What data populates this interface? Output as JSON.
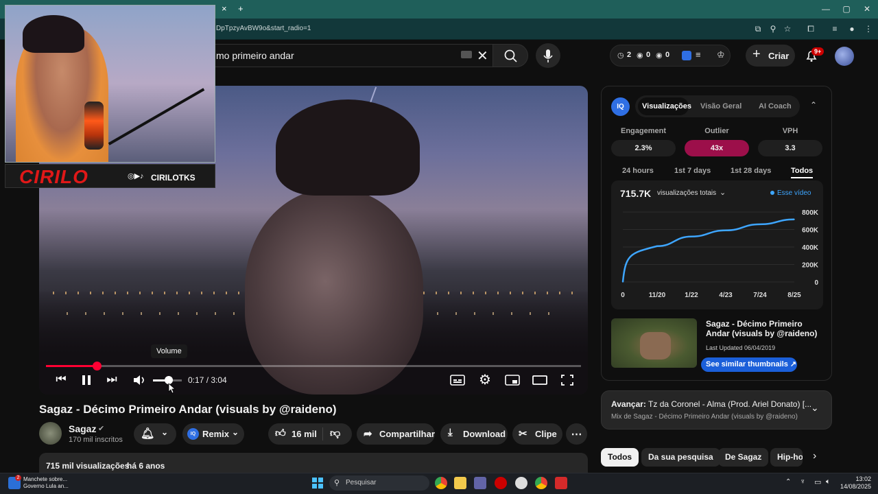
{
  "browser": {
    "url_text": "DpTpzyAvBW9o&start_radio=1",
    "tab_close": "×",
    "tab_new": "+",
    "window_controls": [
      "—",
      "▢",
      "✕"
    ]
  },
  "header": {
    "search_value": "mo primeiro andar",
    "stats": {
      "clock": "2",
      "views_a": "0",
      "views_b": "0"
    },
    "create_label": "Criar",
    "notif_badge": "9+"
  },
  "player": {
    "time": "0:17 / 3:04",
    "tooltip": "Volume",
    "progress": 0.095,
    "volume": 0.55
  },
  "overlay": {
    "name": "CIRILO",
    "handle": "CIRILOTKS"
  },
  "video": {
    "title": "Sagaz - Décimo Primeiro Andar (visuals by @raideno)",
    "channel": "Sagaz",
    "subs": "170 mil inscritos",
    "remix_label": "Remix",
    "likes": "16 mil",
    "share_label": "Compartilhar",
    "download_label": "Download",
    "clip_label": "Clipe",
    "views": "715 mil visualizações",
    "age": "há 6 anos"
  },
  "vidiq": {
    "tabs": [
      "Visualizações",
      "Visão Geral",
      "AI Coach"
    ],
    "metrics": [
      {
        "label": "Engagement",
        "value": "2.3%"
      },
      {
        "label": "Outlier",
        "value": "43x"
      },
      {
        "label": "VPH",
        "value": "3.3"
      }
    ],
    "ranges": [
      "24 hours",
      "1st 7 days",
      "1st 28 days",
      "Todos"
    ],
    "total": "715.7K",
    "total_label": "visualizações totais",
    "legend": "Esse vídeo",
    "related_title": "Sagaz - Décimo Primeiro Andar (visuals by @raideno)",
    "related_updated": "Last Updated 06/04/2019",
    "similar_button": "See similar thumbnails ↗"
  },
  "chart_data": {
    "type": "line",
    "x": [
      "0",
      "11/20",
      "1/22",
      "4/23",
      "7/24",
      "8/25"
    ],
    "y_ticks": [
      "800K",
      "600K",
      "400K",
      "200K",
      "0"
    ],
    "ylim": [
      0,
      800000
    ],
    "series": [
      {
        "name": "Esse vídeo",
        "color": "#3ea6ff",
        "values": [
          0,
          410000,
          520000,
          590000,
          660000,
          715700
        ]
      }
    ]
  },
  "next_up": {
    "label": "Avançar:",
    "title": "Tz da Coronel - Alma (Prod. Ariel Donato) [...",
    "mix": "Mix de Sagaz - Décimo Primeiro Andar (visuals by @raideno)"
  },
  "chips": [
    "Todos",
    "Da sua pesquisa",
    "De Sagaz",
    "Hip-ho"
  ],
  "taskbar": {
    "news_line1": "Manchete sobre...",
    "news_line2": "Governo Lula an...",
    "news_badge": "2",
    "search_placeholder": "Pesquisar",
    "time": "13:02",
    "date": "14/08/2025"
  },
  "colors": {
    "accent_red": "#ff0033",
    "vidiq_blue": "#2f6fe4",
    "outlier_bg": "#9c0f4a"
  }
}
